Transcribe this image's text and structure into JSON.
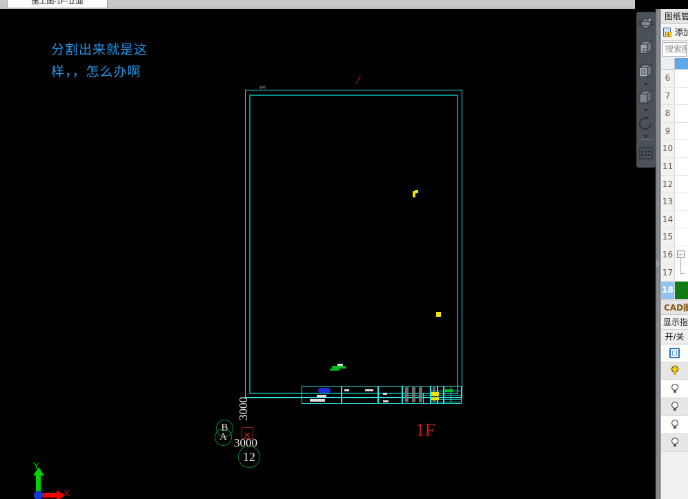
{
  "window": {
    "tab_label": "施工图-1F-立面"
  },
  "canvas": {
    "annotation_note": "分割出来就是这样，，怎么办啊",
    "note_color": "#2196e8",
    "floor_label": "1F",
    "floor_label_color": "#c11b1b",
    "drawing_small_text": "说明",
    "grid_bubbles": [
      {
        "label": "B"
      },
      {
        "label": "A"
      },
      {
        "label": "12"
      }
    ],
    "dimension_vertical": "3000",
    "dimension_horizontal": "3000",
    "frame_color_outer": "#2ee6e0",
    "frame_color_inner": "#0d8d8d",
    "ucs": {
      "x_label": "X",
      "y_label": "Y",
      "x_color": "#ef0000",
      "y_color": "#00d400",
      "origin_color": "#1436d8"
    }
  },
  "navbar": {
    "buttons": [
      {
        "name": "orbit-icon",
        "title": "全导航控制盘"
      },
      {
        "name": "cube-3d-icon",
        "title": "三维视图"
      },
      {
        "name": "wireframe-cube-icon",
        "title": "线框视图"
      },
      {
        "name": "solid-cube-icon",
        "title": "实体视图"
      },
      {
        "name": "rotate-icon",
        "title": "动态观察"
      },
      {
        "name": "grid-settings-icon",
        "title": "视图设置"
      }
    ]
  },
  "dock": {
    "title": "图纸管理",
    "add_button_label": "添加",
    "search_placeholder": "搜索图纸",
    "rows": [
      {
        "num": "6"
      },
      {
        "num": "7"
      },
      {
        "num": "8"
      },
      {
        "num": "9"
      },
      {
        "num": "10"
      },
      {
        "num": "11"
      },
      {
        "num": "12"
      },
      {
        "num": "13"
      },
      {
        "num": "14"
      },
      {
        "num": "15"
      },
      {
        "num": "16",
        "node": "–"
      },
      {
        "num": "17",
        "bracket": true
      },
      {
        "num": "18",
        "selected": true
      }
    ]
  },
  "layers": {
    "panel_title": "CAD图层",
    "sub_label": "显示指定",
    "column_header": "开/关",
    "items": [
      {
        "icon": "frame-icon",
        "state": "current"
      },
      {
        "icon": "bulb-on-icon",
        "state": "on"
      },
      {
        "icon": "bulb-off-icon",
        "state": "off"
      },
      {
        "icon": "bulb-off-icon",
        "state": "off"
      },
      {
        "icon": "bulb-off-icon",
        "state": "off"
      },
      {
        "icon": "bulb-off-icon",
        "state": "off"
      }
    ]
  }
}
